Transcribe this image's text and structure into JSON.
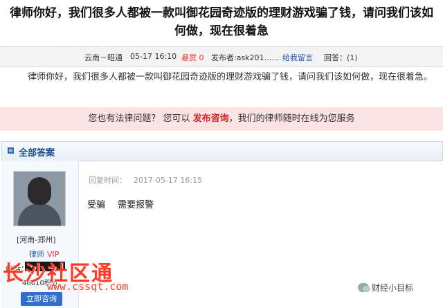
{
  "question": {
    "title": "律师你好，我们很多人都被一款叫御花园奇迹版的理财游戏骗了钱，请问我们该如何做，现在很着急",
    "location": "云南－昭通",
    "time": "05-17 16:10",
    "reward_label": "悬赏",
    "reward_value": "0",
    "asker": "发布者:ask201……",
    "leave_message": "给我留言",
    "answer_count": "回答：(1)",
    "body": "律师你好，我们很多人都被一款叫御花园奇迹版的理财游戏骗了钱，请问我们该如何做，现在很着急。"
  },
  "banner": {
    "prefix": "您也有法律问题？ 您可以",
    "link": "发布咨询",
    "suffix": "，我们的律师随时在线为您服务"
  },
  "answers": {
    "section_title": "全部答案",
    "lawyer": {
      "location": "[河南-郑州]",
      "role": "律师",
      "vip": "VIP",
      "phone_label": "电话：",
      "score": "46610积分",
      "consult_button": "立即咨询"
    },
    "reply": {
      "time_label": "回复时间：",
      "time": "2017-05-17 16:15",
      "text": "受骗 需要报警"
    }
  },
  "watermark": {
    "cn": "长沙社区通",
    "url": "www.cssqt.com"
  },
  "wechat_tag": "财经小目标"
}
